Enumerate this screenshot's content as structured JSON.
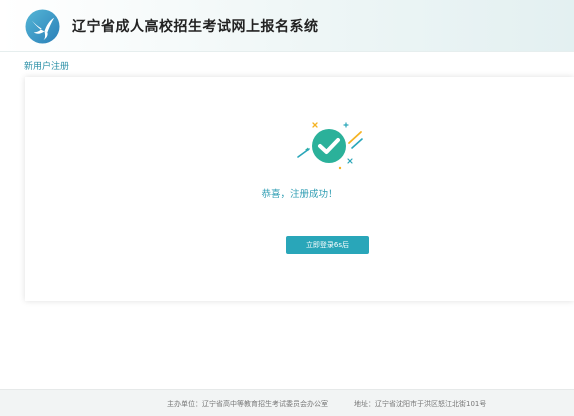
{
  "header": {
    "title": "辽宁省成人高校招生考试网上报名系统",
    "logo_icon": "swallow-logo-icon"
  },
  "breadcrumb": {
    "label": "新用户注册"
  },
  "card": {
    "success_icon": "check-circle-icon",
    "message": "恭喜，注册成功！",
    "login_button_label": "立即登录6s后"
  },
  "footer": {
    "host": "主办单位：辽宁省高中等教育招生考试委员会办公室",
    "address": "地址：辽宁省沈阳市于洪区怒江北街101号"
  },
  "colors": {
    "accent": "#29a6b9",
    "success_green": "#2bb19a",
    "text_teal": "#2f9db3"
  }
}
